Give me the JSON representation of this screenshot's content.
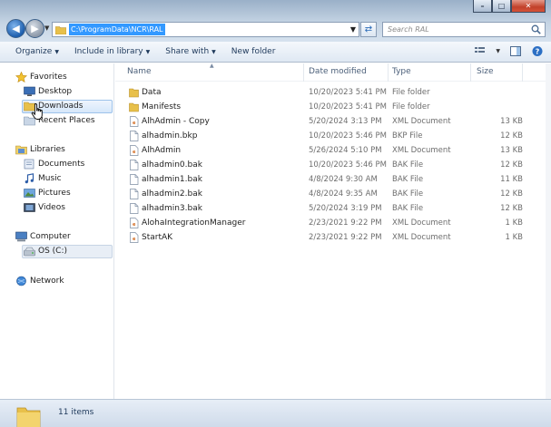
{
  "window": {
    "minimize": "–",
    "maximize": "□",
    "close": "✕"
  },
  "address": {
    "path": "C:\\ProgramData\\NCR\\RAL"
  },
  "search": {
    "placeholder": "Search RAL"
  },
  "toolbar": {
    "organize": "Organize",
    "include_in_library": "Include in library",
    "share_with": "Share with",
    "new_folder": "New folder"
  },
  "sidebar": {
    "favorites": "Favorites",
    "desktop": "Desktop",
    "downloads": "Downloads",
    "recent_places": "Recent Places",
    "libraries": "Libraries",
    "documents": "Documents",
    "music": "Music",
    "pictures": "Pictures",
    "videos": "Videos",
    "computer": "Computer",
    "os_drive": "OS (C:)",
    "network": "Network"
  },
  "columns": {
    "name": "Name",
    "date_modified": "Date modified",
    "type": "Type",
    "size": "Size"
  },
  "files": [
    {
      "name": "Data",
      "date": "10/20/2023 5:41 PM",
      "type": "File folder",
      "size": "",
      "kind": "folder"
    },
    {
      "name": "Manifests",
      "date": "10/20/2023 5:41 PM",
      "type": "File folder",
      "size": "",
      "kind": "folder"
    },
    {
      "name": "AlhAdmin - Copy",
      "date": "5/20/2024 3:13 PM",
      "type": "XML Document",
      "size": "13 KB",
      "kind": "xml"
    },
    {
      "name": "alhadmin.bkp",
      "date": "10/20/2023 5:46 PM",
      "type": "BKP File",
      "size": "12 KB",
      "kind": "file"
    },
    {
      "name": "AlhAdmin",
      "date": "5/26/2024 5:10 PM",
      "type": "XML Document",
      "size": "13 KB",
      "kind": "xml"
    },
    {
      "name": "alhadmin0.bak",
      "date": "10/20/2023 5:46 PM",
      "type": "BAK File",
      "size": "12 KB",
      "kind": "file"
    },
    {
      "name": "alhadmin1.bak",
      "date": "4/8/2024 9:30 AM",
      "type": "BAK File",
      "size": "11 KB",
      "kind": "file"
    },
    {
      "name": "alhadmin2.bak",
      "date": "4/8/2024 9:35 AM",
      "type": "BAK File",
      "size": "12 KB",
      "kind": "file"
    },
    {
      "name": "alhadmin3.bak",
      "date": "5/20/2024 3:19 PM",
      "type": "BAK File",
      "size": "12 KB",
      "kind": "file"
    },
    {
      "name": "AlohaIntegrationManager",
      "date": "2/23/2021 9:22 PM",
      "type": "XML Document",
      "size": "1 KB",
      "kind": "xml"
    },
    {
      "name": "StartAK",
      "date": "2/23/2021 9:22 PM",
      "type": "XML Document",
      "size": "1 KB",
      "kind": "xml"
    }
  ],
  "status": {
    "item_count": "11 items"
  },
  "colors": {
    "selection": "#3399ff",
    "folder": "#e8c04a"
  }
}
